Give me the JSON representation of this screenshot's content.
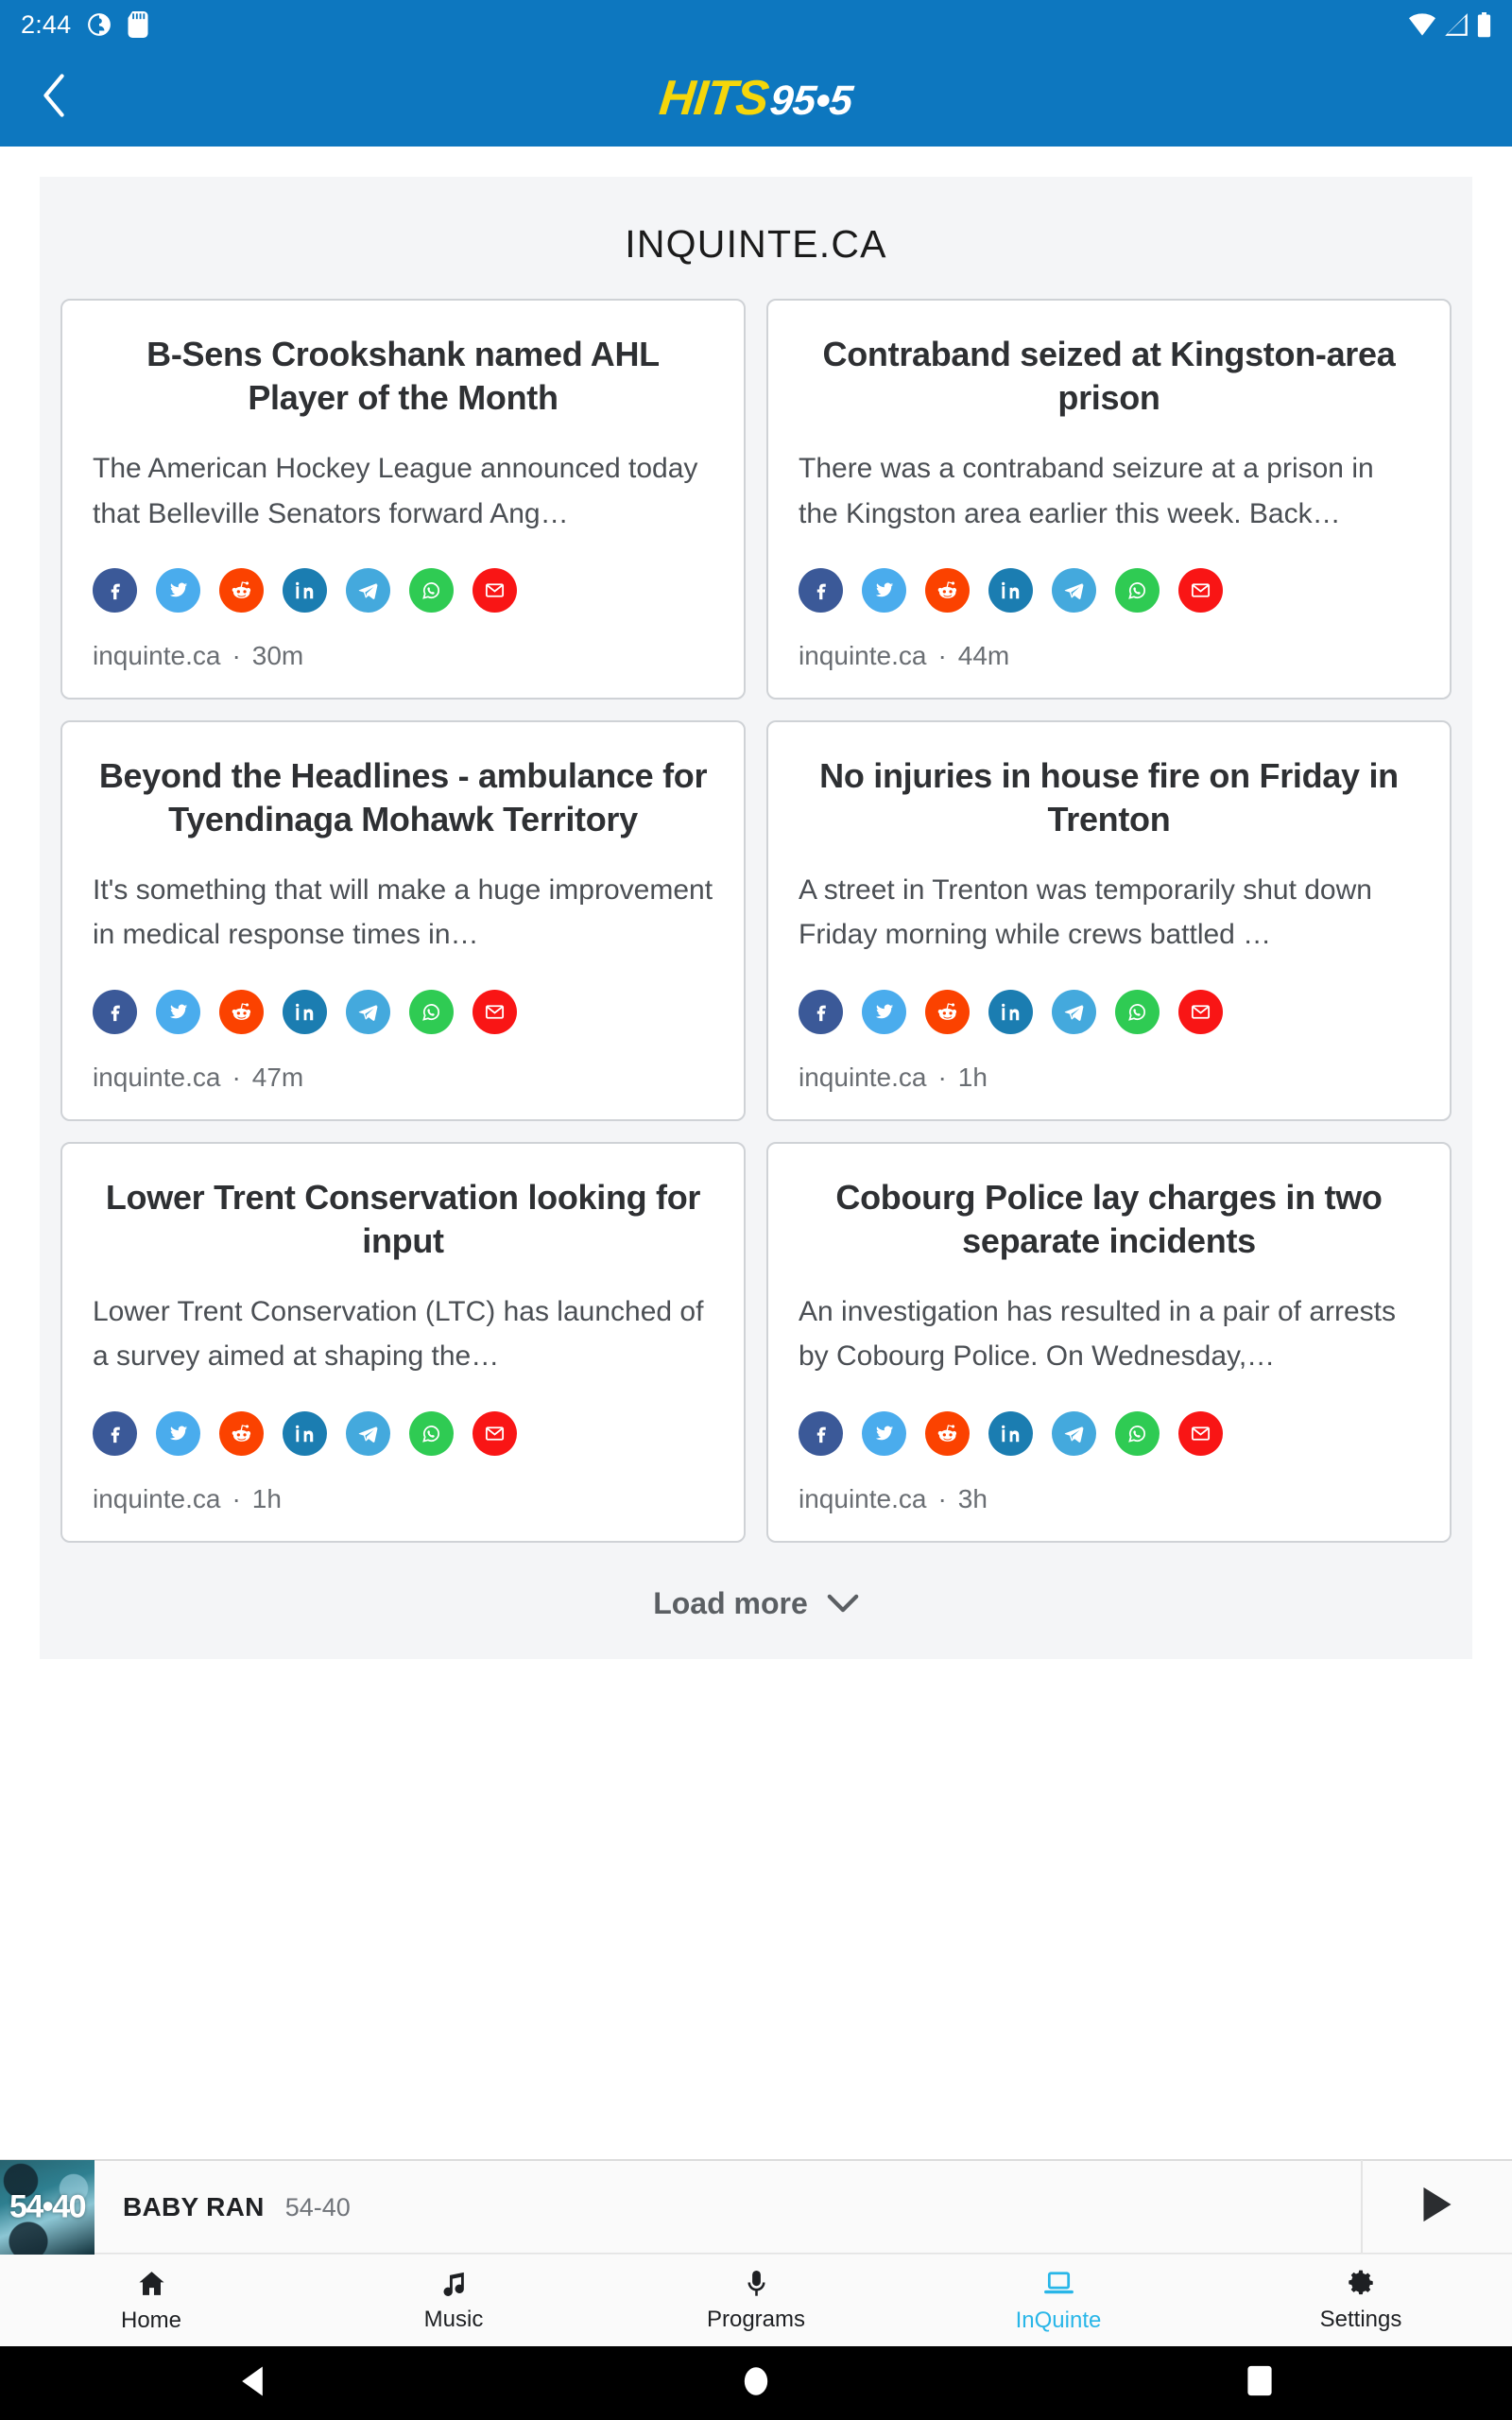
{
  "status_bar": {
    "clock": "2:44",
    "left_icons": [
      "contacts-sync-icon",
      "sd-card-icon"
    ],
    "right_icons": [
      "wifi-icon",
      "cellular-signal-icon",
      "battery-icon"
    ]
  },
  "app_bar": {
    "back_icon": "chevron-left-icon",
    "logo_primary": "HITS",
    "logo_secondary": "95•5"
  },
  "section": {
    "title": "INQUINTE.CA",
    "load_more_label": "Load more",
    "load_more_icon": "chevron-down-icon"
  },
  "share_buttons": [
    {
      "name": "facebook",
      "label": "Facebook",
      "color": "#3b5998"
    },
    {
      "name": "twitter",
      "label": "Twitter",
      "color": "#4aaced"
    },
    {
      "name": "reddit",
      "label": "Reddit",
      "color": "#fb4200"
    },
    {
      "name": "linkedin",
      "label": "LinkedIn",
      "color": "#1b7db1"
    },
    {
      "name": "telegram",
      "label": "Telegram",
      "color": "#44a9dd"
    },
    {
      "name": "whatsapp",
      "label": "WhatsApp",
      "color": "#2fcb53"
    },
    {
      "name": "email",
      "label": "Email",
      "color": "#f91515"
    }
  ],
  "articles_left": [
    {
      "title": "B-Sens Crookshank named AHL Player of the Month",
      "excerpt": "The American Hockey League announced today that Belleville Senators forward Ang…",
      "source": "inquinte.ca",
      "time": "30m"
    },
    {
      "title": "Beyond the Headlines - ambulance for Tyendinaga Mohawk Territory",
      "excerpt": "It's something that will make a huge improvement in medical response times in…",
      "source": "inquinte.ca",
      "time": "47m"
    },
    {
      "title": "Lower Trent Conservation looking for input",
      "excerpt": "Lower Trent Conservation (LTC) has launched of a survey aimed at shaping the…",
      "source": "inquinte.ca",
      "time": "1h"
    }
  ],
  "articles_right": [
    {
      "title": "Contraband seized at Kingston-area prison",
      "excerpt": "There was a contraband seizure at a prison in the Kingston area earlier this week. Back…",
      "source": "inquinte.ca",
      "time": "44m"
    },
    {
      "title": "No injuries in house fire on Friday in Trenton",
      "excerpt": "A street in Trenton was temporarily shut down Friday morning while crews battled …",
      "source": "inquinte.ca",
      "time": "1h"
    },
    {
      "title": "Cobourg Police lay charges in two separate incidents",
      "excerpt": "An investigation has resulted in a pair of arrests by Cobourg Police. On Wednesday,…",
      "source": "inquinte.ca",
      "time": "3h"
    }
  ],
  "player": {
    "album_art_text": "54•40",
    "track_title": "BABY RAN",
    "track_artist": "54-40",
    "play_icon": "play-icon"
  },
  "bottom_nav": {
    "items": [
      {
        "label": "Home",
        "icon": "home-icon",
        "active": false
      },
      {
        "label": "Music",
        "icon": "music-note-icon",
        "active": false
      },
      {
        "label": "Programs",
        "icon": "microphone-icon",
        "active": false
      },
      {
        "label": "InQuinte",
        "icon": "laptop-icon",
        "active": true
      },
      {
        "label": "Settings",
        "icon": "gear-icon",
        "active": false
      }
    ],
    "active_color": "#29b6e8"
  },
  "system_nav": {
    "back": "back-triangle-icon",
    "home": "home-circle-icon",
    "recents": "recents-square-icon"
  },
  "theme": {
    "header_blue": "#0d77bf",
    "logo_yellow": "#f5d60a",
    "panel_bg": "#f4f5f7",
    "card_border": "#cfd2d6"
  }
}
